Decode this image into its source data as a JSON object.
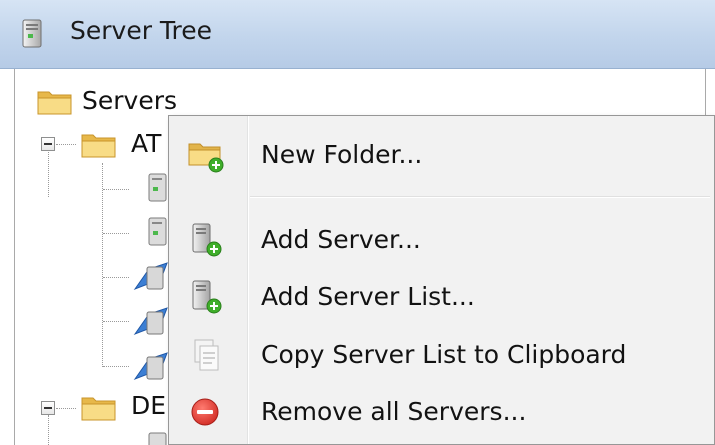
{
  "window": {
    "title": "Server Tree",
    "icon": "server-icon"
  },
  "tree": {
    "root": {
      "label": "Servers",
      "icon": "folder-icon"
    },
    "groups": [
      {
        "label": "AT",
        "icon": "folder-icon",
        "expanded": true
      },
      {
        "label": "DE",
        "icon": "folder-icon",
        "expanded": true
      }
    ]
  },
  "context_menu": {
    "items": [
      {
        "label": "New Folder...",
        "icon": "new-folder-icon"
      },
      {
        "label": "Add Server...",
        "icon": "add-server-icon"
      },
      {
        "label": "Add Server List...",
        "icon": "add-server-list-icon"
      },
      {
        "label": "Copy Server List to Clipboard",
        "icon": "copy-clipboard-icon",
        "disabled_icon": true
      },
      {
        "label": "Remove all Servers...",
        "icon": "remove-icon"
      }
    ],
    "colors": {
      "add_badge": "#3fae2a",
      "remove": "#e23b35",
      "folder": "#f2c94c"
    }
  }
}
